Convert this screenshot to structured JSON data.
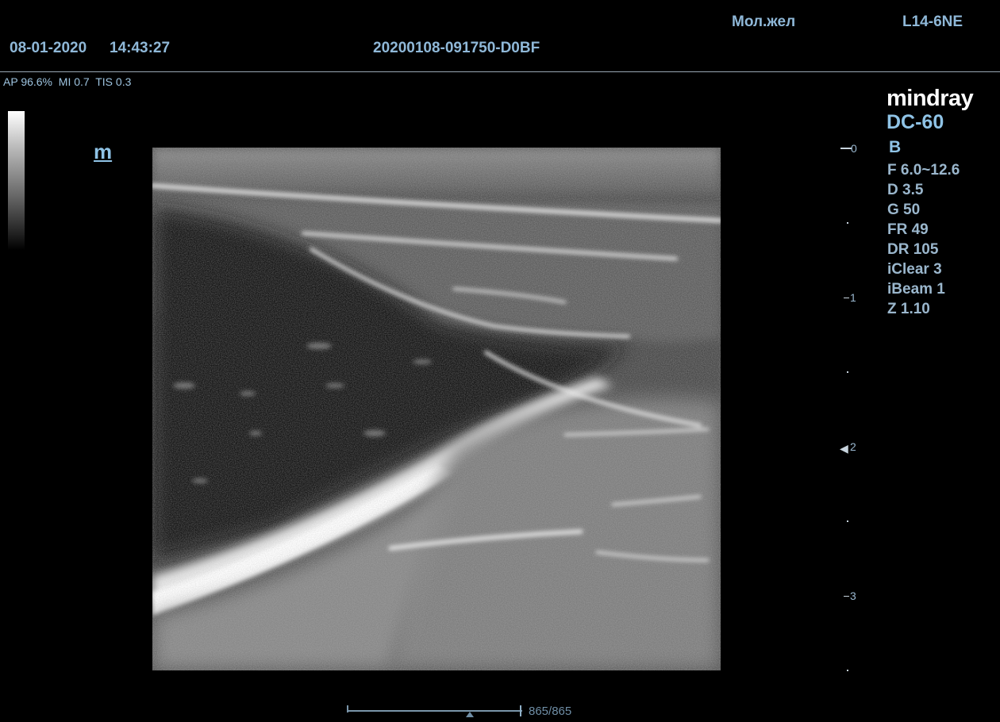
{
  "header": {
    "date": "08-01-2020",
    "time": "14:43:27",
    "patient_id": "20200108-091750-D0BF",
    "exam_preset": "Мол.жел",
    "probe": "L14-6NE",
    "acoustic_power": "AP 96.6%",
    "mechanical_index": "MI 0.7",
    "thermal_index": "TIS 0.3"
  },
  "image": {
    "orientation_marker": "m"
  },
  "depth_scale": {
    "labels": [
      "0",
      "1",
      "2",
      "3"
    ],
    "unit": "cm",
    "focus_depth_cm": 2
  },
  "panel": {
    "brand": "mindray",
    "model": "DC-60",
    "mode": "B",
    "params": [
      "F 6.0~12.6",
      "D 3.5",
      "G 50",
      "FR 49",
      "DR 105",
      "iClear 3",
      "iBeam 1",
      "Z 1.10"
    ]
  },
  "cine": {
    "frame_counter": "865/865",
    "position_fraction": 0.7
  },
  "colors": {
    "overlay_text": "#8fb8d8",
    "brand": "#ffffff",
    "background": "#000000"
  },
  "icons": {
    "focus_marker": "focus-arrow-icon"
  }
}
